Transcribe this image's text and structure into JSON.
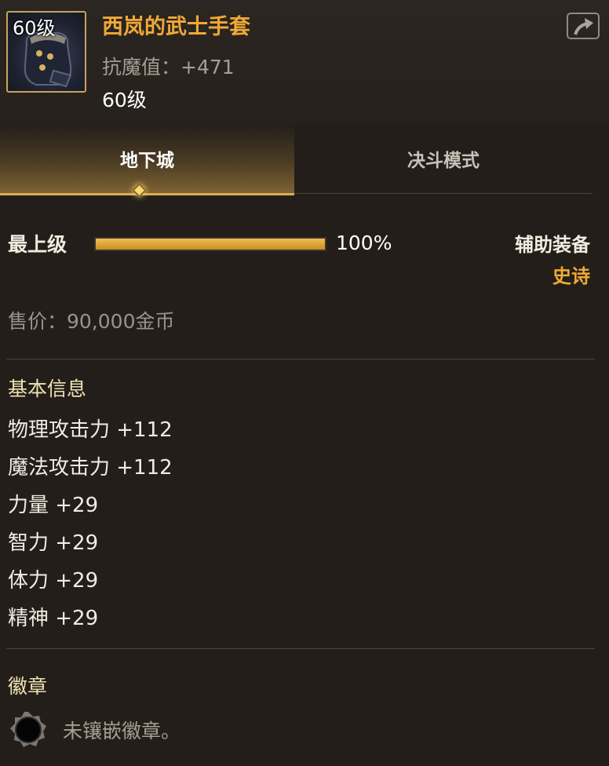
{
  "item": {
    "level_badge": "60级",
    "name": "西岚的武士手套",
    "resist": "抗魔值：+471",
    "req_level": "60级"
  },
  "share_icon": "share-icon",
  "tabs": [
    {
      "label": "地下城",
      "active": true
    },
    {
      "label": "决斗模式",
      "active": false
    }
  ],
  "grade": {
    "label": "最上级",
    "percent": 100,
    "percent_text": "100%"
  },
  "equip_type": "辅助装备",
  "rarity": "史诗",
  "sale_price": "售价：90,000金币",
  "basic_info": {
    "title": "基本信息",
    "stats": [
      "物理攻击力 +112",
      "魔法攻击力 +112",
      "力量 +29",
      "智力 +29",
      "体力 +29",
      "精神 +29"
    ]
  },
  "emblem": {
    "title": "徽章",
    "empty_text": "未镶嵌徽章。"
  },
  "colors": {
    "name_gold": "#f0a935",
    "rarity_gold": "#f0a935",
    "bar_fill": "#e0a83a",
    "background": "#231e19"
  }
}
